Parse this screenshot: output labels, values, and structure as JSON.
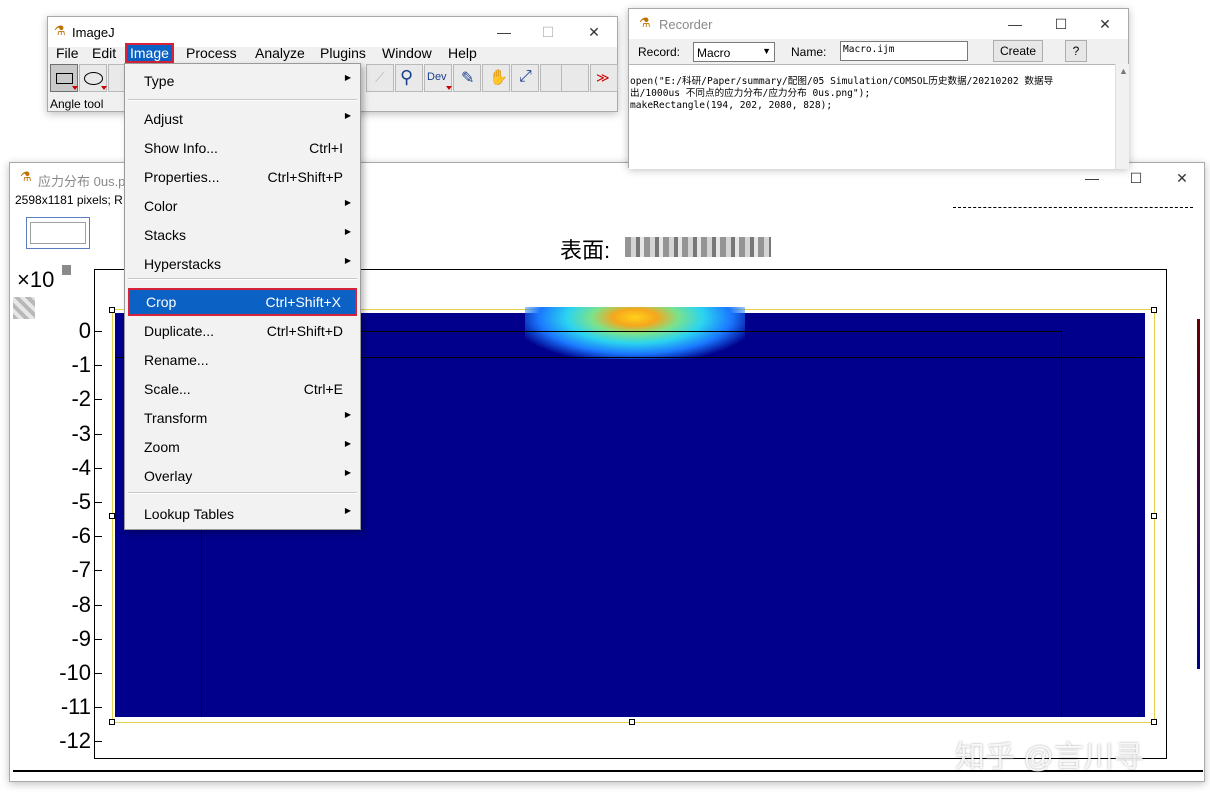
{
  "imagej": {
    "title": "ImageJ",
    "menus": [
      "File",
      "Edit",
      "Image",
      "Process",
      "Analyze",
      "Plugins",
      "Window",
      "Help"
    ],
    "active_menu": "Image",
    "status_text": "Angle tool",
    "dev_label": "Dev",
    "more_label": "≫"
  },
  "image_menu": {
    "items": [
      {
        "label": "Type",
        "shortcut": "",
        "submenu": true
      },
      {
        "label": "Adjust",
        "shortcut": "",
        "submenu": true
      },
      {
        "label": "Show Info...",
        "shortcut": "Ctrl+I",
        "submenu": false
      },
      {
        "label": "Properties...",
        "shortcut": "Ctrl+Shift+P",
        "submenu": false
      },
      {
        "label": "Color",
        "shortcut": "",
        "submenu": true
      },
      {
        "label": "Stacks",
        "shortcut": "",
        "submenu": true
      },
      {
        "label": "Hyperstacks",
        "shortcut": "",
        "submenu": true
      },
      {
        "label": "Crop",
        "shortcut": "Ctrl+Shift+X",
        "submenu": false
      },
      {
        "label": "Duplicate...",
        "shortcut": "Ctrl+Shift+D",
        "submenu": false
      },
      {
        "label": "Rename...",
        "shortcut": "",
        "submenu": false
      },
      {
        "label": "Scale...",
        "shortcut": "Ctrl+E",
        "submenu": false
      },
      {
        "label": "Transform",
        "shortcut": "",
        "submenu": true
      },
      {
        "label": "Zoom",
        "shortcut": "",
        "submenu": true
      },
      {
        "label": "Overlay",
        "shortcut": "",
        "submenu": true
      },
      {
        "label": "Lookup Tables",
        "shortcut": "",
        "submenu": true
      }
    ],
    "highlighted": "Crop"
  },
  "recorder": {
    "title": "Recorder",
    "record_label": "Record:",
    "record_value": "Macro",
    "name_label": "Name:",
    "name_value": "Macro.ijm",
    "create_label": "Create",
    "help_label": "?",
    "code_lines": [
      "open(\"E:/科研/Paper/summary/配图/05 Simulation/COMSOL历史数据/20210202 数据导",
      "出/1000us 不同点的应力分布/应力分布 0us.png\");",
      "makeRectangle(194, 202, 2080, 828);"
    ]
  },
  "image_window": {
    "title": "应力分布 0us.png",
    "info_text": "2598x1181 pixels; R",
    "plot_title": "表面:",
    "y_multiplier": "×10",
    "y_ticks": [
      "0",
      "-1",
      "-2",
      "-3",
      "-4",
      "-5",
      "-6",
      "-7",
      "-8",
      "-9",
      "-10",
      "-11",
      "-12"
    ]
  },
  "watermark": "知乎 @言川寻",
  "colors": {
    "menu_highlight": "#0b62c4",
    "highlight_border": "#d6233a",
    "plot_fill": "#00008c"
  }
}
